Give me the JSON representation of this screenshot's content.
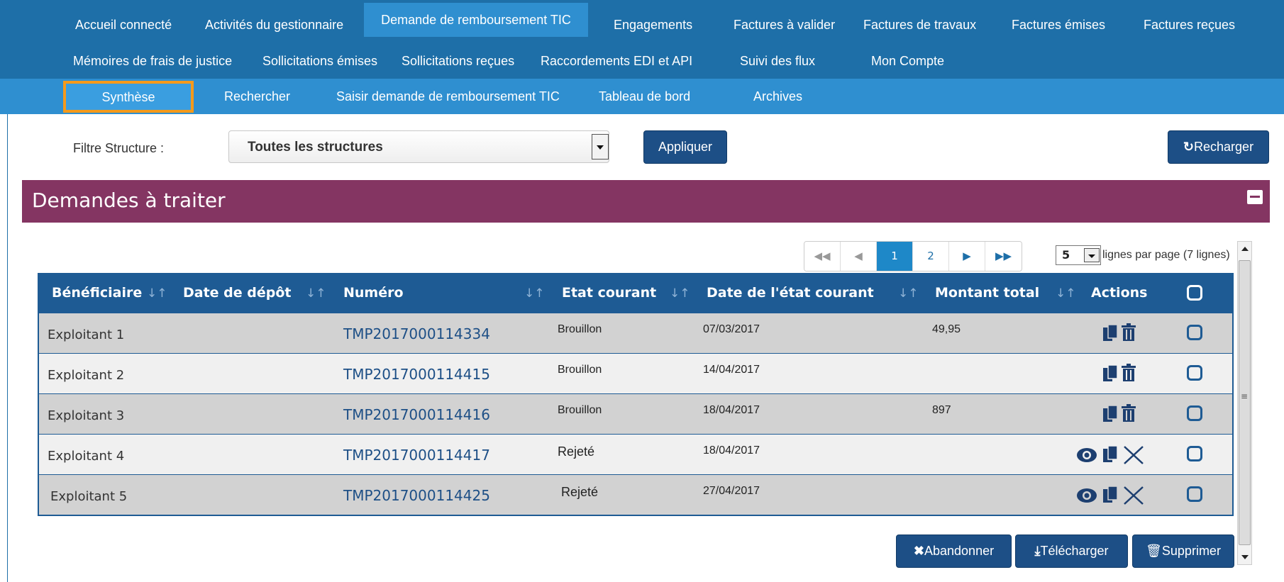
{
  "nav": {
    "row1": [
      "Accueil connecté",
      "Activités du gestionnaire",
      "Demande de remboursement TIC",
      "Engagements",
      "Factures à valider",
      "Factures de travaux",
      "Factures émises",
      "Factures reçues"
    ],
    "row2": [
      "Mémoires de frais de justice",
      "Sollicitations émises",
      "Sollicitations reçues",
      "Raccordements EDI et API",
      "Suivi des flux",
      "Mon Compte"
    ],
    "active": "Demande de remboursement TIC"
  },
  "subnav": {
    "items": [
      "Synthèse",
      "Rechercher",
      "Saisir demande de remboursement TIC",
      "Tableau de bord",
      "Archives"
    ],
    "active": "Synthèse"
  },
  "filter": {
    "label": "Filtre Structure :",
    "value": "Toutes les structures",
    "apply": "Appliquer",
    "reload": "Recharger"
  },
  "panel": {
    "title": "Demandes à traiter"
  },
  "pager": {
    "pages": [
      "1",
      "2"
    ],
    "current": "1",
    "rows_per_page": "5",
    "rows_text": "lignes par page (7 lignes)"
  },
  "table": {
    "headers": [
      "Bénéficiaire",
      "Date de dépôt",
      "Numéro",
      "Etat courant",
      "Date de l'état courant",
      "Montant total",
      "Actions"
    ],
    "rows": [
      {
        "beneficiaire": "Exploitant 1",
        "numero": "TMP2017000114334",
        "etat": "Brouillon",
        "date": "07/03/2017",
        "montant": "49,95",
        "actions": [
          "copy-icon",
          "trash-icon"
        ]
      },
      {
        "beneficiaire": "Exploitant 2",
        "numero": "TMP2017000114415",
        "etat": "Brouillon",
        "date": "14/04/2017",
        "montant": "",
        "actions": [
          "copy-icon",
          "trash-icon"
        ]
      },
      {
        "beneficiaire": "Exploitant 3",
        "numero": "TMP2017000114416",
        "etat": "Brouillon",
        "date": "18/04/2017",
        "montant": "897",
        "actions": [
          "copy-icon",
          "trash-icon"
        ]
      },
      {
        "beneficiaire": "Exploitant 4",
        "numero": "TMP2017000114417",
        "etat": "Rejeté",
        "date": "18/04/2017",
        "montant": "",
        "actions": [
          "eye-icon",
          "copy-icon",
          "close-icon"
        ]
      },
      {
        "beneficiaire": "Exploitant 5",
        "numero": "TMP2017000114425",
        "etat": "Rejeté",
        "date": "27/04/2017",
        "montant": "",
        "actions": [
          "eye-icon",
          "copy-icon",
          "close-icon"
        ]
      }
    ]
  },
  "bottom": {
    "abandon": "Abandonner",
    "download": "Télécharger",
    "delete": "Supprimer"
  },
  "colors": {
    "nav": "#1e6fa8",
    "subnav": "#2f8fd0",
    "panel": "#843562",
    "button": "#1d4f86",
    "highlight": "#f59a1b"
  }
}
